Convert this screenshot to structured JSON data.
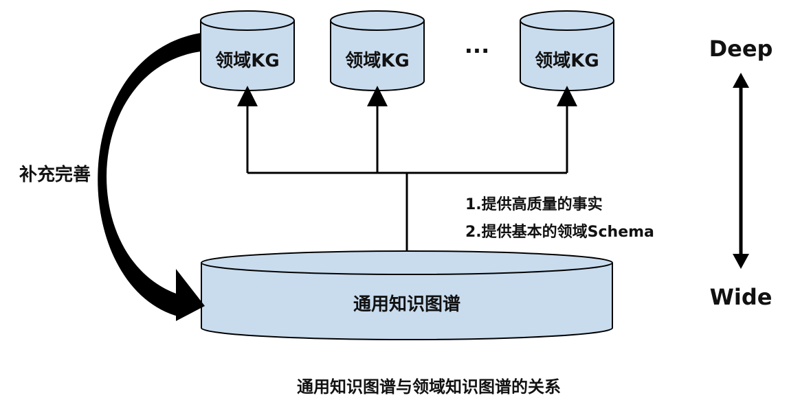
{
  "domain_kg": {
    "nodes": [
      {
        "label": "领域KG"
      },
      {
        "label": "领域KG"
      },
      {
        "label": "领域KG"
      }
    ],
    "ellipsis": "···"
  },
  "general_kg": {
    "label": "通用知识图谱"
  },
  "left_arrow_label": "补充完善",
  "notes": {
    "line1": "1.提供高质量的事实",
    "line2": "2.提供基本的领域Schema"
  },
  "scale": {
    "top": "Deep",
    "bottom": "Wide"
  },
  "caption": "通用知识图谱与领域知识图谱的关系",
  "colors": {
    "fill": "#c9dcee",
    "stroke": "#000000"
  }
}
